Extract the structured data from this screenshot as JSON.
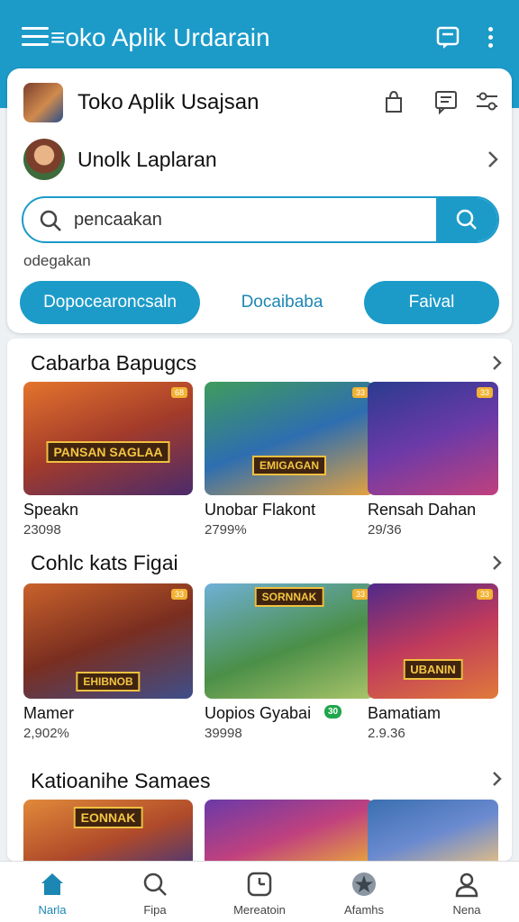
{
  "topbar": {
    "title": "≡oko Aplik Urdarain"
  },
  "store": {
    "name": "Toko Aplik Usajsan"
  },
  "profile": {
    "name": "Unolk Laplaran"
  },
  "search": {
    "value": "pencaakan",
    "placeholder": "pencaakan"
  },
  "hint": "odegakan",
  "buttons": {
    "a": "Dopocearoncsaln",
    "b": "Docaibaba",
    "c": "Faival"
  },
  "sections": [
    {
      "title": "Cabarba Bapugcs",
      "items": [
        {
          "name": "Speakn",
          "count": "23098",
          "art": "PANSAN SAGLAA",
          "badge": "68"
        },
        {
          "name": "Unobar Flakont",
          "count": "2799%",
          "art": "EMIGAGAN",
          "badge": "33"
        },
        {
          "name": "Rensah Dahan",
          "count": "29/36",
          "art": "",
          "badge": "33"
        }
      ]
    },
    {
      "title": "Cohlc kats Figai",
      "items": [
        {
          "name": "Mamer",
          "count": "2,902%",
          "art": "EHIBNOB",
          "badge": "33"
        },
        {
          "name": "Uopios Gyabai",
          "count": "39998",
          "art": "SORNNAK",
          "badge": "33",
          "tag": "30"
        },
        {
          "name": "Bamatiam",
          "count": "2.9.36",
          "art": "UBANIN",
          "badge": "33"
        }
      ]
    },
    {
      "title": "Katioanihe Samaes",
      "items": [
        {
          "name": "",
          "count": "",
          "art": "EONNAK",
          "badge": ""
        },
        {
          "name": "",
          "count": "",
          "art": "",
          "badge": ""
        },
        {
          "name": "",
          "count": "",
          "art": "",
          "badge": ""
        }
      ]
    }
  ],
  "nav": [
    {
      "label": "Narla",
      "icon": "home-icon",
      "active": true
    },
    {
      "label": "Fipa",
      "icon": "search-icon"
    },
    {
      "label": "Mereatoin",
      "icon": "clock-icon"
    },
    {
      "label": "Afamhs",
      "icon": "star-icon"
    },
    {
      "label": "Nena",
      "icon": "person-icon"
    }
  ],
  "colors": {
    "primary": "#1c9bc9",
    "accent_text": "#1c87b3"
  }
}
